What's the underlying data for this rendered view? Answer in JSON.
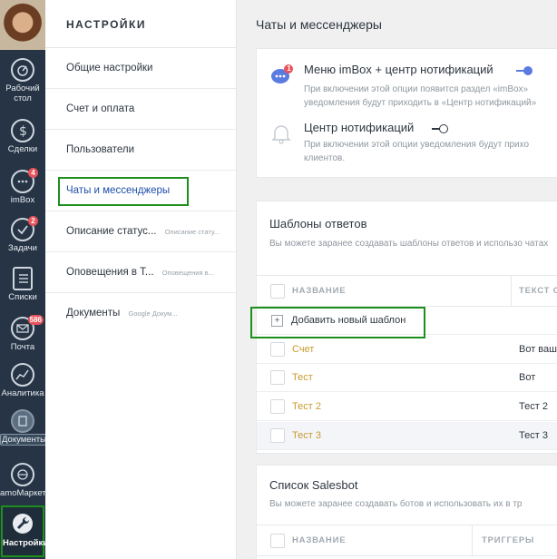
{
  "rail": {
    "items": [
      {
        "label_line1": "Рабочий",
        "label_line2": "стол",
        "icon": "dashboard-icon"
      },
      {
        "label": "Сделки",
        "icon": "dollar-icon"
      },
      {
        "label": "imBox",
        "badge": "4",
        "icon": "chat-icon"
      },
      {
        "label": "Задачи",
        "badge": "2",
        "icon": "check-icon"
      },
      {
        "label": "Списки",
        "icon": "list-icon"
      },
      {
        "label": "Почта",
        "badge": "586",
        "icon": "mail-icon"
      },
      {
        "label": "Аналитика",
        "icon": "analytics-icon"
      },
      {
        "label": "Документы",
        "icon": "documents-icon"
      },
      {
        "label": "amoМаркет",
        "icon": "market-icon"
      },
      {
        "label": "Настройки",
        "icon": "wrench-icon"
      }
    ]
  },
  "menu": {
    "title": "НАСТРОЙКИ",
    "items": [
      {
        "label": "Общие настройки",
        "sub": ""
      },
      {
        "label": "Счет и оплата",
        "sub": ""
      },
      {
        "label": "Пользователи",
        "sub": ""
      },
      {
        "label": "Чаты и мессенджеры",
        "sub": ""
      },
      {
        "label": "Описание статус...",
        "sub": "Описание стату..."
      },
      {
        "label": "Оповещения в Т...",
        "sub": "Оповещения в..."
      },
      {
        "label": "Документы",
        "sub": "Google Докум..."
      }
    ]
  },
  "main": {
    "title": "Чаты и мессенджеры",
    "options": [
      {
        "title": "Меню imBox + центр нотификаций",
        "badge": "1",
        "state": "on",
        "desc_line1": "При включении этой опции появится раздел «imBox»",
        "desc_line2": "уведомления будут приходить в «Центр нотификаций»"
      },
      {
        "title": "Центр нотификаций",
        "state": "off",
        "desc_line1": "При включении этой опции уведомления будут прихо",
        "desc_line2": "клиентов."
      }
    ],
    "templates": {
      "title": "Шаблоны ответов",
      "desc": "Вы можете заранее создавать шаблоны ответов и использо чатах",
      "columns": [
        "НАЗВАНИЕ",
        "ТЕКСТ О"
      ],
      "add_label": "Добавить новый шаблон",
      "add_icon": "+",
      "rows": [
        {
          "name": "Счет",
          "text": "Вот ваша"
        },
        {
          "name": "Тест",
          "text": "Вот"
        },
        {
          "name": "Тест 2",
          "text": "Тест 2"
        },
        {
          "name": "Тест 3",
          "text": "Тест 3"
        }
      ]
    },
    "salesbot": {
      "title": "Список Salesbot",
      "desc": "Вы можете заранее создавать ботов и использовать их в тр",
      "columns": [
        "НАЗВАНИЕ",
        "ТРИГГЕРЫ"
      ]
    }
  },
  "colors": {
    "rail_bg": "#263445",
    "highlight": "#1d8f1d",
    "active_link": "#1e4fa8",
    "template_name": "#c99a2e",
    "toggle_on": "#5b7be0",
    "badge": "#e8525a"
  }
}
